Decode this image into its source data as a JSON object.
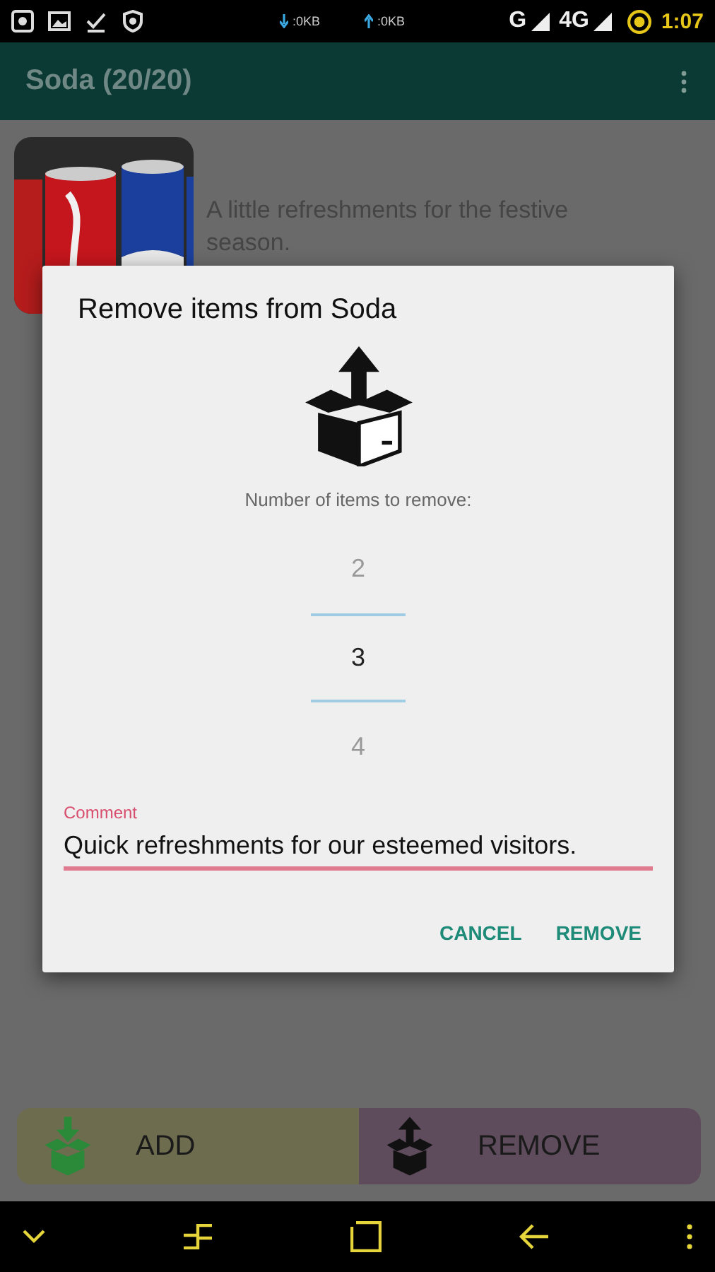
{
  "status_bar": {
    "download_speed": ":0KB",
    "upload_speed": ":0KB",
    "network_1": "G",
    "network_2": "4G",
    "time": "1:07"
  },
  "app_bar": {
    "title": "Soda (20/20)"
  },
  "item": {
    "description": "A little refreshments for the festive season."
  },
  "dialog": {
    "title": "Remove items from Soda",
    "prompt": "Number of items to remove:",
    "picker": [
      {
        "value": "2",
        "selected": false
      },
      {
        "value": "3",
        "selected": true
      },
      {
        "value": "4",
        "selected": false
      }
    ],
    "comment": {
      "label": "Comment",
      "value": "Quick refreshments for our esteemed visitors."
    },
    "buttons": [
      "CANCEL",
      "REMOVE"
    ]
  },
  "actions": [
    {
      "kind": "add",
      "label": "ADD"
    },
    {
      "kind": "remove",
      "label": "REMOVE"
    }
  ]
}
